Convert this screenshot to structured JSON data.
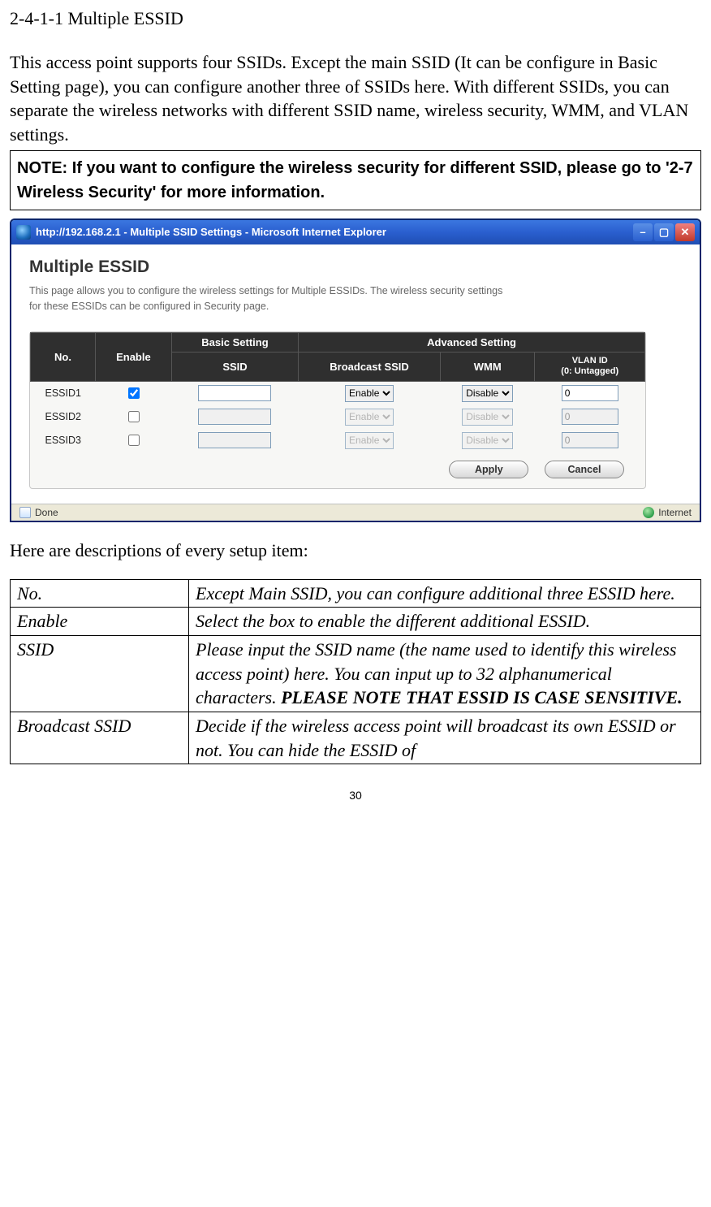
{
  "section_heading": "2-4-1-1 Multiple ESSID",
  "intro_para": "This access point supports four SSIDs. Except the main SSID (It can be configure in Basic Setting page), you can configure another three of SSIDs here. With different SSIDs, you can separate the wireless networks with different SSID name, wireless security, WMM, and VLAN settings.",
  "note_box": "NOTE: If you want to configure the wireless security for different SSID, please go to '2-7 Wireless Security' for more information.",
  "ie": {
    "title": "http://192.168.2.1 - Multiple SSID Settings - Microsoft Internet Explorer",
    "page_title": "Multiple ESSID",
    "page_desc": "This page allows you to configure the wireless settings for Multiple ESSIDs. The wireless security settings for these ESSIDs can be configured in Security page.",
    "headers": {
      "no": "No.",
      "enable": "Enable",
      "basic": "Basic Setting",
      "advanced": "Advanced Setting",
      "ssid": "SSID",
      "broadcast": "Broadcast SSID",
      "wmm": "WMM",
      "vlan": "VLAN ID\n(0: Untagged)"
    },
    "rows": [
      {
        "label": "ESSID1",
        "enabled": true,
        "ssid": "",
        "broadcast": "Enable",
        "wmm": "Disable",
        "vlan": "0"
      },
      {
        "label": "ESSID2",
        "enabled": false,
        "ssid": "",
        "broadcast": "Enable",
        "wmm": "Disable",
        "vlan": "0"
      },
      {
        "label": "ESSID3",
        "enabled": false,
        "ssid": "",
        "broadcast": "Enable",
        "wmm": "Disable",
        "vlan": "0"
      }
    ],
    "apply": "Apply",
    "cancel": "Cancel",
    "status_done": "Done",
    "status_zone": "Internet"
  },
  "desc_intro": "Here are descriptions of every setup item:",
  "desc_rows": [
    {
      "term": "No.",
      "desc": "Except Main SSID, you can configure additional three ESSID here."
    },
    {
      "term": "Enable",
      "desc": "Select the box to enable the different additional ESSID."
    },
    {
      "term": "SSID",
      "desc": "Please input the SSID name (the name used to identify this wireless access point) here. You can input up to 32 alphanumerical characters. ",
      "desc_bold": "PLEASE NOTE THAT ESSID IS CASE SENSITIVE."
    },
    {
      "term": "Broadcast SSID",
      "desc": "Decide if the wireless access point will broadcast its own ESSID or not. You can hide the ESSID of"
    }
  ],
  "page_number": "30"
}
